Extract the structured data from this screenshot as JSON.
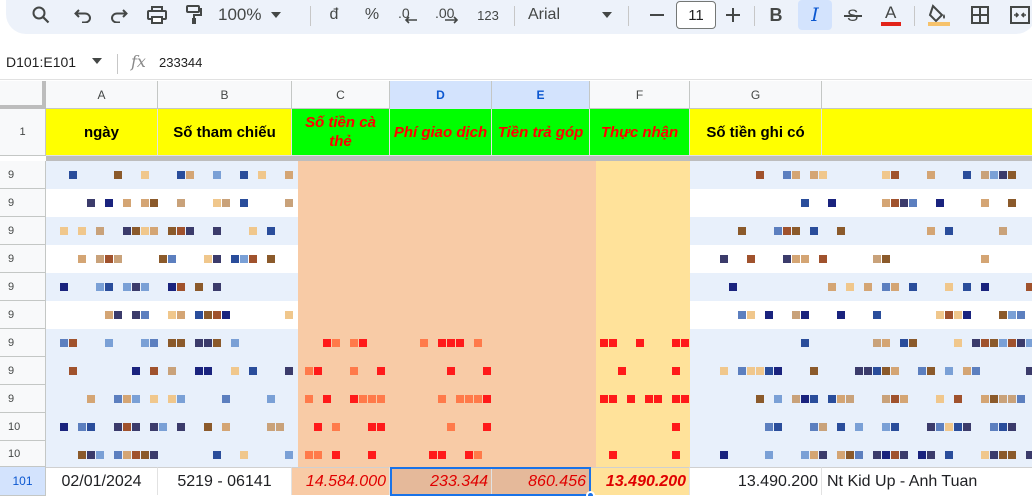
{
  "toolbar": {
    "zoom": "100%",
    "currency_symbol": "đ",
    "percent_symbol": "%",
    "number_format": "123",
    "font": "Arial",
    "font_size": "11",
    "icons": [
      "search-icon",
      "undo-icon",
      "redo-icon",
      "print-icon",
      "paint-format-icon",
      "decrease-decimal-icon",
      "increase-decimal-icon",
      "minus-icon",
      "plus-icon",
      "bold-icon",
      "italic-icon",
      "strikethrough-icon",
      "text-color-icon",
      "fill-color-icon",
      "borders-icon",
      "merge-cells-icon"
    ],
    "colors": {
      "text_color_bar": "#e2231a",
      "fill_color_bar": "#f6c26b",
      "italic_active_bg": "#d3e3fd"
    }
  },
  "formula_bar": {
    "name_box": "D101:E101",
    "fx": "fx",
    "value": "233344"
  },
  "columns": [
    "A",
    "B",
    "C",
    "D",
    "E",
    "F",
    "G"
  ],
  "header_row": {
    "row_number": "1",
    "cells": [
      "ngày",
      "Số tham chiếu",
      "Số tiền cà thẻ",
      "Phí giao dịch",
      "Tiền trả góp",
      "Thực nhận",
      "Số tiền ghi có"
    ]
  },
  "visible_row_labels": [
    "9",
    "9",
    "9",
    "9",
    "9",
    "9",
    "9",
    "9",
    "9",
    "10",
    "10",
    "101"
  ],
  "row_101": {
    "row_number": "101",
    "date": "02/01/2024",
    "reference": "5219 - 06141",
    "card_amount": "14.584.000",
    "fee": "233.344",
    "installment": "860.456",
    "net_received": "13.490.200",
    "credited": "13.490.200",
    "description": "Nt Kid Up - Anh Tuan"
  },
  "colors": {
    "header_yellow": "#ffff00",
    "header_green": "#00ff00",
    "header_red_text": "#ff0000",
    "orange_fill": "#f8cba6",
    "light_orange_fill": "#ffe29a",
    "blue_row": "#e8f0fb",
    "selection": "#1a73e8"
  }
}
